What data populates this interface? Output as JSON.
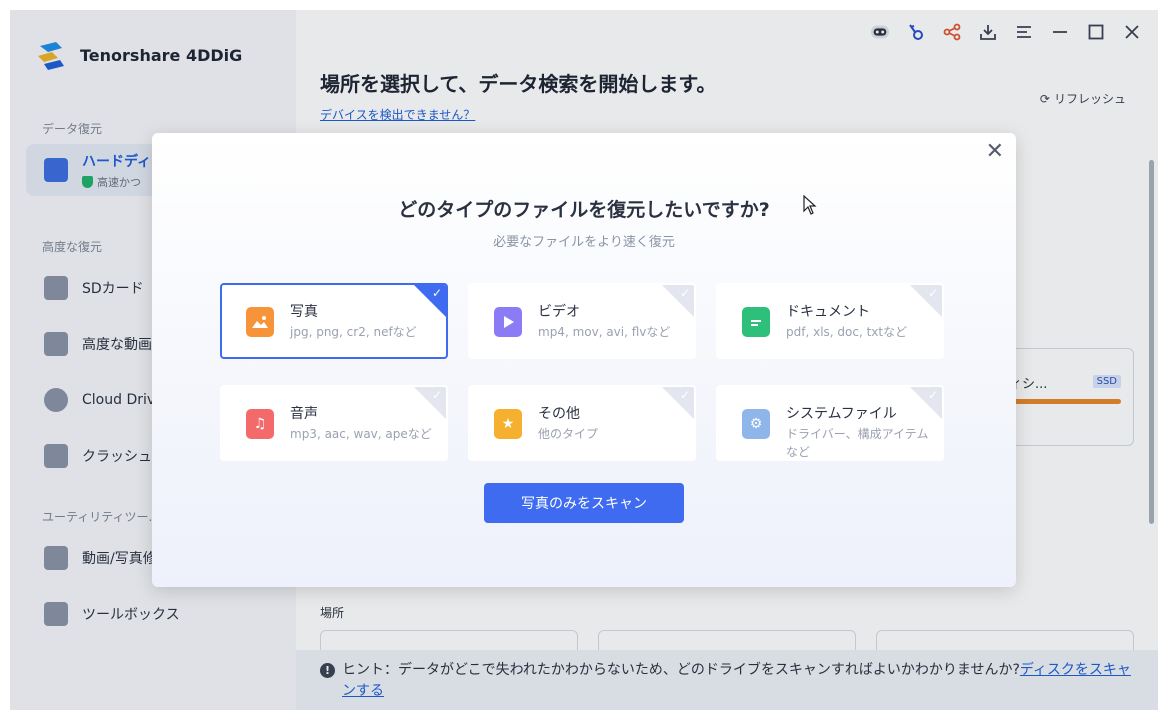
{
  "app": {
    "name": "Tenorshare 4DDiG"
  },
  "sidebar": {
    "sections": {
      "recovery": "データ復元",
      "advanced": "高度な復元",
      "utility": "ユーティリティツー..."
    },
    "items": [
      {
        "label": "ハードディ",
        "sub": "高速かつ"
      },
      {
        "label": "SDカード"
      },
      {
        "label": "高度な動画"
      },
      {
        "label": "Cloud Driv"
      },
      {
        "label": "クラッシュ"
      },
      {
        "label": "動画/写真修"
      },
      {
        "label": "ツールボックス"
      }
    ]
  },
  "main": {
    "title": "場所を選択して、データ検索を開始します。",
    "detect_link": "デバイスを検出できません？",
    "refresh": "リフレッシュ",
    "drive": {
      "name": "ィシ...",
      "badge": "SSD"
    },
    "place_label": "場所",
    "hint": {
      "prefix": "ヒント：データがどこで失われたかわからないため、どのドライブをスキャンすればよいかわかりませんか?",
      "link": "ディスクをスキャンする"
    }
  },
  "modal": {
    "title": "どのタイプのファイルを復元したいですか?",
    "subtitle": "必要なファイルをより速く復元",
    "scan_button": "写真のみをスキャン",
    "types": [
      {
        "name": "写真",
        "desc": "jpg, png, cr2, nefなど",
        "selected": true,
        "color": "#f7943a"
      },
      {
        "name": "ビデオ",
        "desc": "mp4, mov, avi, flvなど",
        "selected": false,
        "color": "#8b7cf5"
      },
      {
        "name": "ドキュメント",
        "desc": "pdf, xls, doc, txtなど",
        "selected": false,
        "color": "#2ec07a"
      },
      {
        "name": "音声",
        "desc": "mp3, aac, wav, apeなど",
        "selected": false,
        "color": "#f26a6a"
      },
      {
        "name": "その他",
        "desc": "他のタイプ",
        "selected": false,
        "color": "#f5b030"
      },
      {
        "name": "システムファイル",
        "desc": "ドライバー、構成アイテムなど",
        "selected": false,
        "color": "#8fb6ea"
      }
    ]
  },
  "colors": {
    "accent": "#3e6bf0",
    "link": "#1e5ed8"
  }
}
